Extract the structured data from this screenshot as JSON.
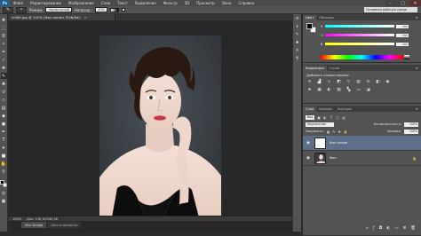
{
  "menubar": {
    "logo": "Ps",
    "items": [
      "Файл",
      "Редактирование",
      "Изображение",
      "Слои",
      "Текст",
      "Выделение",
      "Фильтр",
      "3D",
      "Просмотр",
      "Окно",
      "Справка"
    ],
    "minimize": "–",
    "maximize": "□",
    "close": "✕"
  },
  "options": {
    "mode_label": "Режим:",
    "mode_value": "Нормальный",
    "opacity_label": "Непрозр.:",
    "opacity_value": "45%",
    "workspace_value": "Основная рабочая среда"
  },
  "document": {
    "tab_title": "fc960.jpg @ 100% (Фон копия, RGB/8#)",
    "tab_close": "×",
    "zoom": "100%",
    "doc_info": "Док: 136,1K/345,4K"
  },
  "bottom_tabs": [
    "Mini Bridge",
    "Шкала времени"
  ],
  "color_panel": {
    "tabs": [
      "Цвет",
      "Образцы"
    ],
    "sliders": [
      {
        "label": "R",
        "value": "255",
        "gradient": "linear-gradient(90deg,#00ffff,#ffffff)"
      },
      {
        "label": "G",
        "value": "255",
        "gradient": "linear-gradient(90deg,#ff00ff,#ffffff)"
      },
      {
        "label": "B",
        "value": "255",
        "gradient": "linear-gradient(90deg,#ffff00,#ffffff)"
      }
    ]
  },
  "adjust_panel": {
    "tabs": [
      "Коррекция",
      "Стили"
    ],
    "title": "Добавить корректировку"
  },
  "layers_panel": {
    "tabs": [
      "Слои",
      "Каналы",
      "Контуры"
    ],
    "filter_value": "Вид",
    "blend_value": "Нормальные",
    "opacity_label": "Непрозрачность:",
    "opacity_value": "100%",
    "lock_label": "Закрепить:",
    "fill_label": "Заливка:",
    "fill_value": "100%",
    "layers": [
      {
        "name": "Фон копия",
        "selected": true
      },
      {
        "name": "Фон",
        "selected": false,
        "locked": true
      }
    ]
  }
}
